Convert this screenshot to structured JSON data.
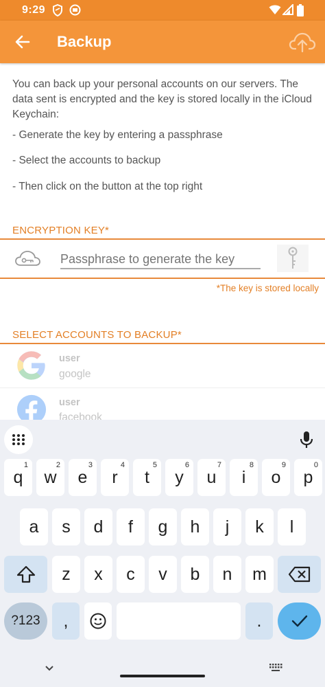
{
  "status_bar": {
    "time": "9:29",
    "icons": [
      "shield-icon",
      "app-badge-icon",
      "wifi-icon",
      "signal-icon",
      "battery-icon"
    ]
  },
  "app_bar": {
    "title": "Backup",
    "back_icon": "arrow-left-icon",
    "action_icon": "cloud-upload-icon"
  },
  "intro": {
    "text": "You can back up your personal accounts on our servers. The data sent is encrypted and the key is stored locally in the iCloud Keychain:",
    "steps": [
      "- Generate the key by entering a passphrase",
      "- Select the accounts to backup",
      "- Then click on the button at the top right"
    ]
  },
  "encryption": {
    "header": "ENCRYPTION KEY*",
    "placeholder": "Passphrase to generate the key",
    "value": "",
    "note": "*The key is stored locally"
  },
  "accounts": {
    "header": "SELECT ACCOUNTS TO BACKUP*",
    "items": [
      {
        "user": "user",
        "service": "google",
        "icon": "google-logo-icon"
      },
      {
        "user": "user",
        "service": "facebook",
        "icon": "facebook-logo-icon"
      }
    ]
  },
  "keyboard": {
    "row1": [
      {
        "k": "q",
        "h": "1"
      },
      {
        "k": "w",
        "h": "2"
      },
      {
        "k": "e",
        "h": "3"
      },
      {
        "k": "r",
        "h": "4"
      },
      {
        "k": "t",
        "h": "5"
      },
      {
        "k": "y",
        "h": "6"
      },
      {
        "k": "u",
        "h": "7"
      },
      {
        "k": "i",
        "h": "8"
      },
      {
        "k": "o",
        "h": "9"
      },
      {
        "k": "p",
        "h": "0"
      }
    ],
    "row2": [
      "a",
      "s",
      "d",
      "f",
      "g",
      "h",
      "j",
      "k",
      "l"
    ],
    "row3": [
      "z",
      "x",
      "c",
      "v",
      "b",
      "n",
      "m"
    ],
    "symbols_label": "?123",
    "comma": ",",
    "period": "."
  },
  "colors": {
    "accent": "#f4953a",
    "status_bar": "#ee8a2c",
    "accent_text": "#e37f25",
    "enter_key": "#5eb5ec"
  }
}
